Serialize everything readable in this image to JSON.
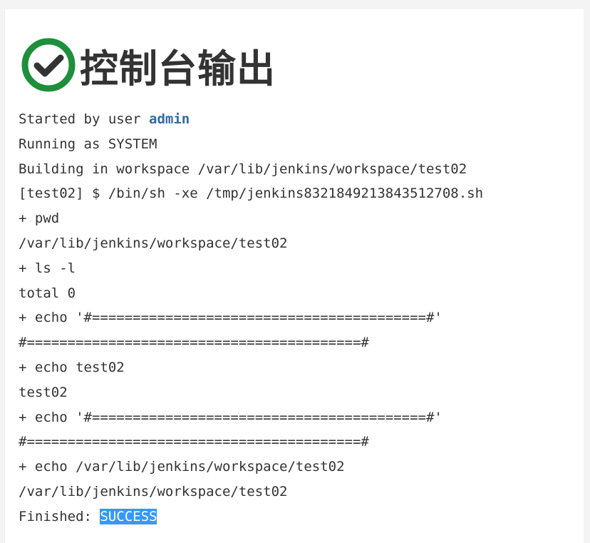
{
  "header": {
    "title": "控制台输出",
    "status_icon": "check-circle-icon",
    "status_color": "#1e8f3c"
  },
  "console": {
    "started_prefix": "Started by user ",
    "user": "admin",
    "lines": [
      "Running as SYSTEM",
      "Building in workspace /var/lib/jenkins/workspace/test02",
      "[test02] $ /bin/sh -xe /tmp/jenkins8321849213843512708.sh",
      "+ pwd",
      "/var/lib/jenkins/workspace/test02",
      "+ ls -l",
      "total 0",
      "+ echo '#=========================================#'",
      "#=========================================#",
      "+ echo test02",
      "test02",
      "+ echo '#=========================================#'",
      "#=========================================#",
      "+ echo /var/lib/jenkins/workspace/test02",
      "/var/lib/jenkins/workspace/test02"
    ],
    "finished_prefix": "Finished: ",
    "result": "SUCCESS"
  },
  "colors": {
    "link": "#2f6ba8",
    "highlight": "#3399ff",
    "text": "#333333"
  }
}
